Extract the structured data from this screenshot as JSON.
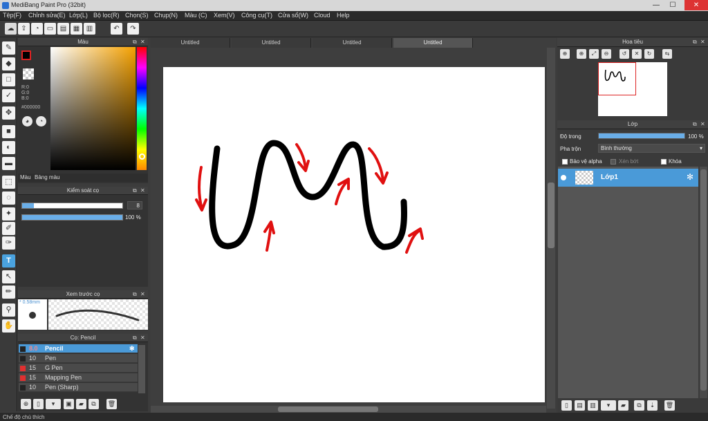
{
  "window": {
    "title": "MediBang Paint Pro (32bit)",
    "minimize": "—",
    "maximize": "☐",
    "close": "✕"
  },
  "menu": [
    "Tệp(F)",
    "Chỉnh sửa(E)",
    "Lớp(L)",
    "Bộ lọc(R)",
    "Chọn(S)",
    "Chụp(N)",
    "Màu (C)",
    "Xem(V)",
    "Công cụ(T)",
    "Cửa sổ(W)",
    "Cloud",
    "Help"
  ],
  "toolbar_icons": [
    "cloud-icon",
    "upload-icon",
    "speech-bubble-icon",
    "comment-icon",
    "page-icon",
    "grid-icon",
    "layout-icon",
    "undo-icon",
    "redo-icon"
  ],
  "left_tools": [
    "brush-icon",
    "eraser-icon",
    "rectangle-icon",
    "pen-icon",
    "move-icon",
    "fill-square-icon",
    "bucket-icon",
    "gradient-icon",
    "select-rect-icon",
    "lasso-icon",
    "magic-wand-icon",
    "select-pen-icon",
    "select-eraser-icon",
    "text-icon",
    "operation-icon",
    "eyedropper-icon",
    "dropper-icon",
    "hand-icon"
  ],
  "color_panel": {
    "title": "Màu",
    "r": "R:0",
    "g": "G:0",
    "b": "B:0",
    "hex": "#000000",
    "fg_color": "#000000",
    "tabs": [
      "Màu",
      "Bảng màu"
    ]
  },
  "brush_control": {
    "title": "Kiểm soát cọ",
    "size": "8",
    "opacity": "100 %",
    "size_fraction": 0.12,
    "opacity_fraction": 1.0
  },
  "brush_preview": {
    "title": "Xem trước cọ",
    "size": "* 0.58mm"
  },
  "brush_list": {
    "title": "Cọ: Pencil",
    "items": [
      {
        "size": "8.0",
        "name": "Pencil",
        "color": "#222222",
        "selected": true
      },
      {
        "size": "10",
        "name": "Pen",
        "color": "#222222"
      },
      {
        "size": "15",
        "name": "G Pen",
        "color": "#e03030"
      },
      {
        "size": "15",
        "name": "Mapping Pen",
        "color": "#e03030"
      },
      {
        "size": "10",
        "name": "Pen (Sharp)",
        "color": "#222222"
      }
    ]
  },
  "doc_tabs": [
    "Untitled",
    "Untitled",
    "Untitled",
    "Untitled"
  ],
  "navigator": {
    "title": "Hoa tiêu"
  },
  "layers": {
    "title": "Lớp",
    "opacity_label": "Độ trong",
    "opacity_value": "100 %",
    "opacity_fraction": 1.0,
    "blend_label": "Pha trộn",
    "blend_value": "Bình thường",
    "protect_alpha": "Bảo vệ alpha",
    "clipping": "Xén bớt",
    "lock": "Khóa",
    "items": [
      {
        "name": "Lớp1",
        "visible": true
      }
    ]
  },
  "status": "Chế độ chú thích"
}
